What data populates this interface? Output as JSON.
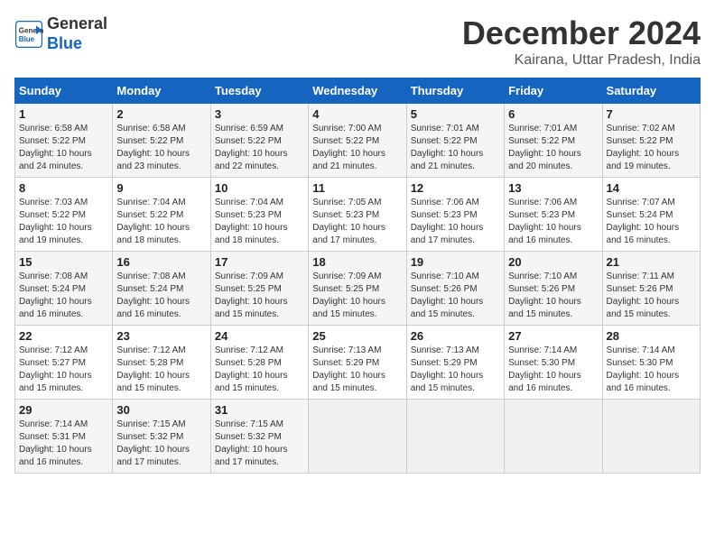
{
  "header": {
    "logo_line1": "General",
    "logo_line2": "Blue",
    "month": "December 2024",
    "location": "Kairana, Uttar Pradesh, India"
  },
  "weekdays": [
    "Sunday",
    "Monday",
    "Tuesday",
    "Wednesday",
    "Thursday",
    "Friday",
    "Saturday"
  ],
  "weeks": [
    [
      {
        "day": "1",
        "sunrise": "6:58 AM",
        "sunset": "5:22 PM",
        "daylight": "10 hours and 24 minutes."
      },
      {
        "day": "2",
        "sunrise": "6:58 AM",
        "sunset": "5:22 PM",
        "daylight": "10 hours and 23 minutes."
      },
      {
        "day": "3",
        "sunrise": "6:59 AM",
        "sunset": "5:22 PM",
        "daylight": "10 hours and 22 minutes."
      },
      {
        "day": "4",
        "sunrise": "7:00 AM",
        "sunset": "5:22 PM",
        "daylight": "10 hours and 21 minutes."
      },
      {
        "day": "5",
        "sunrise": "7:01 AM",
        "sunset": "5:22 PM",
        "daylight": "10 hours and 21 minutes."
      },
      {
        "day": "6",
        "sunrise": "7:01 AM",
        "sunset": "5:22 PM",
        "daylight": "10 hours and 20 minutes."
      },
      {
        "day": "7",
        "sunrise": "7:02 AM",
        "sunset": "5:22 PM",
        "daylight": "10 hours and 19 minutes."
      }
    ],
    [
      {
        "day": "8",
        "sunrise": "7:03 AM",
        "sunset": "5:22 PM",
        "daylight": "10 hours and 19 minutes."
      },
      {
        "day": "9",
        "sunrise": "7:04 AM",
        "sunset": "5:22 PM",
        "daylight": "10 hours and 18 minutes."
      },
      {
        "day": "10",
        "sunrise": "7:04 AM",
        "sunset": "5:23 PM",
        "daylight": "10 hours and 18 minutes."
      },
      {
        "day": "11",
        "sunrise": "7:05 AM",
        "sunset": "5:23 PM",
        "daylight": "10 hours and 17 minutes."
      },
      {
        "day": "12",
        "sunrise": "7:06 AM",
        "sunset": "5:23 PM",
        "daylight": "10 hours and 17 minutes."
      },
      {
        "day": "13",
        "sunrise": "7:06 AM",
        "sunset": "5:23 PM",
        "daylight": "10 hours and 16 minutes."
      },
      {
        "day": "14",
        "sunrise": "7:07 AM",
        "sunset": "5:24 PM",
        "daylight": "10 hours and 16 minutes."
      }
    ],
    [
      {
        "day": "15",
        "sunrise": "7:08 AM",
        "sunset": "5:24 PM",
        "daylight": "10 hours and 16 minutes."
      },
      {
        "day": "16",
        "sunrise": "7:08 AM",
        "sunset": "5:24 PM",
        "daylight": "10 hours and 16 minutes."
      },
      {
        "day": "17",
        "sunrise": "7:09 AM",
        "sunset": "5:25 PM",
        "daylight": "10 hours and 15 minutes."
      },
      {
        "day": "18",
        "sunrise": "7:09 AM",
        "sunset": "5:25 PM",
        "daylight": "10 hours and 15 minutes."
      },
      {
        "day": "19",
        "sunrise": "7:10 AM",
        "sunset": "5:26 PM",
        "daylight": "10 hours and 15 minutes."
      },
      {
        "day": "20",
        "sunrise": "7:10 AM",
        "sunset": "5:26 PM",
        "daylight": "10 hours and 15 minutes."
      },
      {
        "day": "21",
        "sunrise": "7:11 AM",
        "sunset": "5:26 PM",
        "daylight": "10 hours and 15 minutes."
      }
    ],
    [
      {
        "day": "22",
        "sunrise": "7:12 AM",
        "sunset": "5:27 PM",
        "daylight": "10 hours and 15 minutes."
      },
      {
        "day": "23",
        "sunrise": "7:12 AM",
        "sunset": "5:28 PM",
        "daylight": "10 hours and 15 minutes."
      },
      {
        "day": "24",
        "sunrise": "7:12 AM",
        "sunset": "5:28 PM",
        "daylight": "10 hours and 15 minutes."
      },
      {
        "day": "25",
        "sunrise": "7:13 AM",
        "sunset": "5:29 PM",
        "daylight": "10 hours and 15 minutes."
      },
      {
        "day": "26",
        "sunrise": "7:13 AM",
        "sunset": "5:29 PM",
        "daylight": "10 hours and 15 minutes."
      },
      {
        "day": "27",
        "sunrise": "7:14 AM",
        "sunset": "5:30 PM",
        "daylight": "10 hours and 16 minutes."
      },
      {
        "day": "28",
        "sunrise": "7:14 AM",
        "sunset": "5:30 PM",
        "daylight": "10 hours and 16 minutes."
      }
    ],
    [
      {
        "day": "29",
        "sunrise": "7:14 AM",
        "sunset": "5:31 PM",
        "daylight": "10 hours and 16 minutes."
      },
      {
        "day": "30",
        "sunrise": "7:15 AM",
        "sunset": "5:32 PM",
        "daylight": "10 hours and 17 minutes."
      },
      {
        "day": "31",
        "sunrise": "7:15 AM",
        "sunset": "5:32 PM",
        "daylight": "10 hours and 17 minutes."
      },
      null,
      null,
      null,
      null
    ]
  ]
}
